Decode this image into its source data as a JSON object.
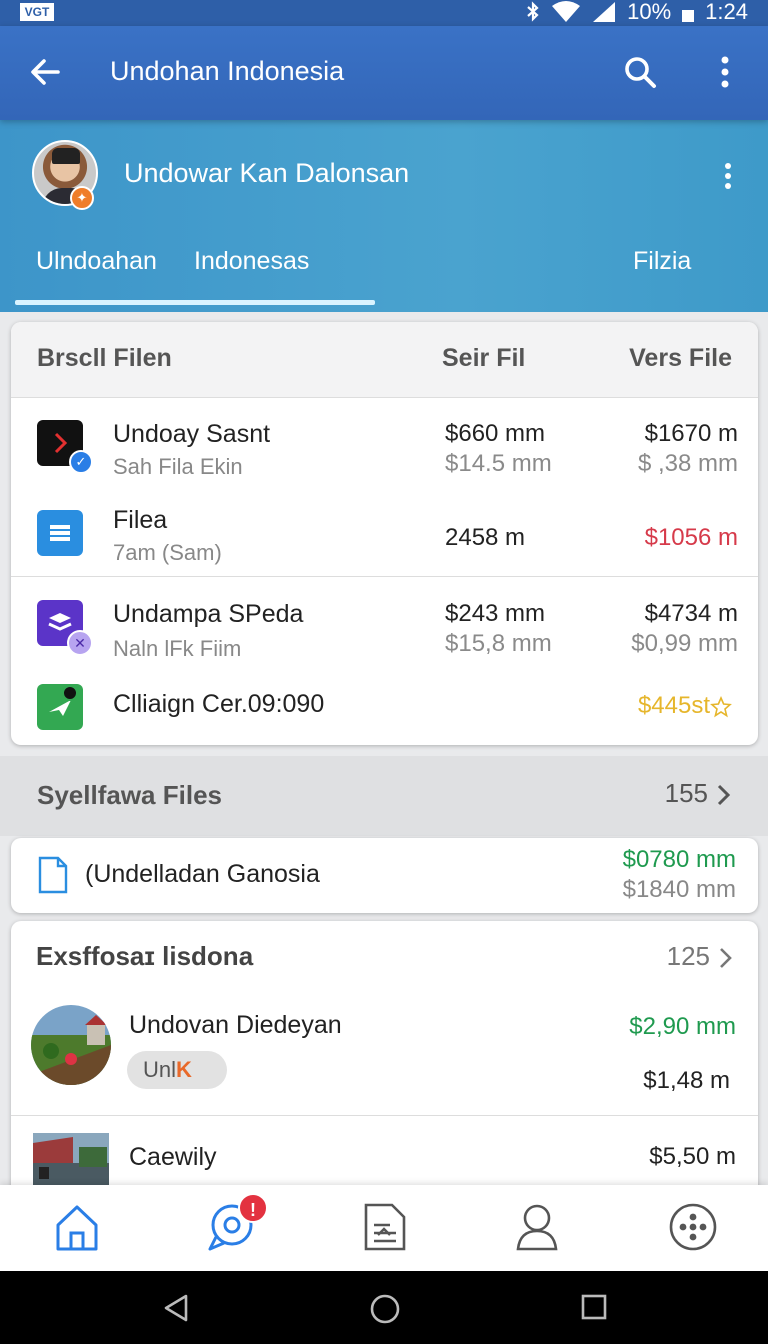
{
  "status_bar": {
    "battery": "10%",
    "time": "1:24",
    "carrier_logo": "VGT"
  },
  "app_bar": {
    "title": "Undohan Indonesia",
    "icons": [
      "back-arrow-icon",
      "search-icon",
      "more-vert-icon"
    ]
  },
  "profile": {
    "name": "Undowar Kan Dalonsan",
    "tabs": [
      {
        "label": "Ulndoahan"
      },
      {
        "label": "Indonesas"
      },
      {
        "label": "Filzia"
      }
    ]
  },
  "files_table": {
    "headers": {
      "col1": "Brscll Filen",
      "col2": "Seir Fil",
      "col3": "Vers File"
    },
    "rows": [
      {
        "title": "Undoay Sasnt",
        "subtitle": "Sah Fila Ekin",
        "col2_main": "$660 mm",
        "col2_sub": "$14.5 mm",
        "col3_main": "$1670 m",
        "col3_sub": "$   ,38 mm"
      },
      {
        "title": "Filea",
        "subtitle": "7am (Sam)",
        "col2_main": "2458 m",
        "col3_main": "$1056 m"
      },
      {
        "title": "Undampa SPeda",
        "subtitle": "Naln lFk Fiim",
        "col2_main": "$243 mm",
        "col2_sub": "$15,8 mm",
        "col3_main": "$4734 m",
        "col3_sub": "$0,99 mm"
      },
      {
        "title": "Clliaign Cer.09:090",
        "col3_main": "$445st"
      }
    ]
  },
  "section": {
    "title": "Syellfawa Files",
    "count": "155"
  },
  "file_card": {
    "title": "(Undelladan Ganosia",
    "value_main": "$0780 mm",
    "value_sub": "$1840 mm"
  },
  "list_card": {
    "title": "Exsffosaɪ lisdona",
    "count": "125",
    "items": [
      {
        "title": "Undovan Diedeyan",
        "chip": "Unl",
        "chip_accent": "K",
        "value_main": "$2,90 mm",
        "value_sub": "$1,48 m"
      },
      {
        "title": "Caewily",
        "value_main": "$5,50 m"
      }
    ]
  },
  "bottom_nav": {
    "items": [
      "home-icon",
      "chat-icon",
      "document-icon",
      "person-icon",
      "apps-icon"
    ],
    "badge": "!"
  },
  "colors": {
    "app_bar": "#3a72c6",
    "header": "#4aa3cf",
    "positive": "#1f9a4f",
    "negative": "#d63a4a",
    "warning": "#e6b62c"
  }
}
